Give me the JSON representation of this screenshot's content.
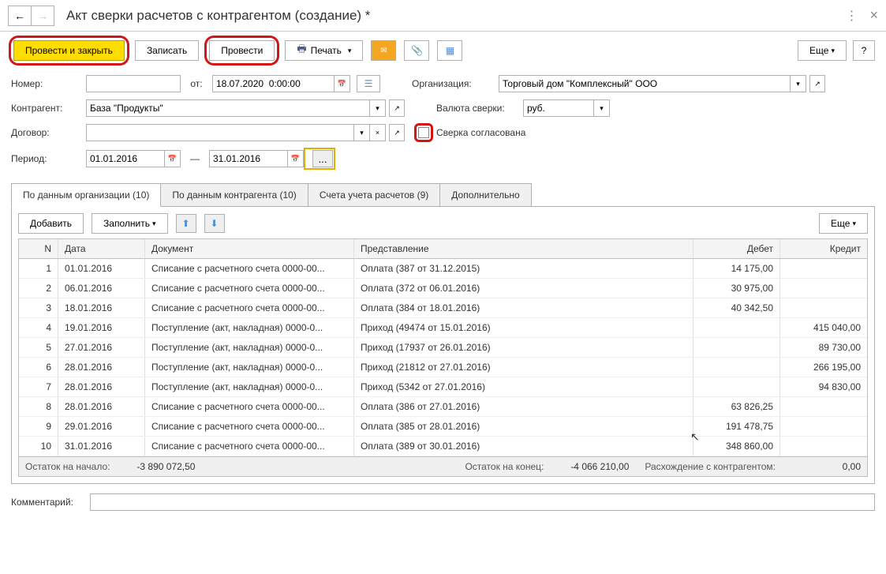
{
  "header": {
    "title": "Акт сверки расчетов с контрагентом (создание) *"
  },
  "toolbar": {
    "post_close": "Провести и закрыть",
    "write": "Записать",
    "post": "Провести",
    "print": "Печать",
    "more": "Еще"
  },
  "form": {
    "number_label": "Номер:",
    "number": "",
    "date_label": "от:",
    "date": "18.07.2020  0:00:00",
    "org_label": "Организация:",
    "org": "Торговый дом \"Комплексный\" ООО",
    "counterparty_label": "Контрагент:",
    "counterparty": "База \"Продукты\"",
    "currency_label": "Валюта сверки:",
    "currency": "руб.",
    "contract_label": "Договор:",
    "contract": "",
    "agreed_label": "Сверка согласована",
    "period_label": "Период:",
    "period_from": "01.01.2016",
    "period_to": "31.01.2016",
    "period_dash": "—"
  },
  "tabs": {
    "org_data": "По данным организации (10)",
    "cp_data": "По данным контрагента (10)",
    "accounts": "Счета учета расчетов (9)",
    "extra": "Дополнительно"
  },
  "tab_toolbar": {
    "add": "Добавить",
    "fill": "Заполнить",
    "more": "Еще"
  },
  "columns": {
    "n": "N",
    "date": "Дата",
    "doc": "Документ",
    "repr": "Представление",
    "debit": "Дебет",
    "credit": "Кредит"
  },
  "rows": [
    {
      "n": "1",
      "date": "01.01.2016",
      "doc": "Списание с расчетного счета 0000-00...",
      "repr": "Оплата (387 от 31.12.2015)",
      "debit": "14 175,00",
      "credit": ""
    },
    {
      "n": "2",
      "date": "06.01.2016",
      "doc": "Списание с расчетного счета 0000-00...",
      "repr": "Оплата (372 от 06.01.2016)",
      "debit": "30 975,00",
      "credit": ""
    },
    {
      "n": "3",
      "date": "18.01.2016",
      "doc": "Списание с расчетного счета 0000-00...",
      "repr": "Оплата (384 от 18.01.2016)",
      "debit": "40 342,50",
      "credit": ""
    },
    {
      "n": "4",
      "date": "19.01.2016",
      "doc": "Поступление (акт, накладная) 0000-0...",
      "repr": "Приход (49474 от 15.01.2016)",
      "debit": "",
      "credit": "415 040,00"
    },
    {
      "n": "5",
      "date": "27.01.2016",
      "doc": "Поступление (акт, накладная) 0000-0...",
      "repr": "Приход (17937 от 26.01.2016)",
      "debit": "",
      "credit": "89 730,00"
    },
    {
      "n": "6",
      "date": "28.01.2016",
      "doc": "Поступление (акт, накладная) 0000-0...",
      "repr": "Приход (21812 от 27.01.2016)",
      "debit": "",
      "credit": "266 195,00"
    },
    {
      "n": "7",
      "date": "28.01.2016",
      "doc": "Поступление (акт, накладная) 0000-0...",
      "repr": "Приход (5342 от 27.01.2016)",
      "debit": "",
      "credit": "94 830,00"
    },
    {
      "n": "8",
      "date": "28.01.2016",
      "doc": "Списание с расчетного счета 0000-00...",
      "repr": "Оплата (386 от 27.01.2016)",
      "debit": "63 826,25",
      "credit": ""
    },
    {
      "n": "9",
      "date": "29.01.2016",
      "doc": "Списание с расчетного счета 0000-00...",
      "repr": "Оплата (385 от 28.01.2016)",
      "debit": "191 478,75",
      "credit": ""
    },
    {
      "n": "10",
      "date": "31.01.2016",
      "doc": "Списание с расчетного счета 0000-00...",
      "repr": "Оплата (389 от 30.01.2016)",
      "debit": "348 860,00",
      "credit": ""
    }
  ],
  "footer": {
    "start_label": "Остаток на начало:",
    "start_val": "-3 890 072,50",
    "end_label": "Остаток на конец:",
    "end_val": "-4 066 210,00",
    "diff_label": "Расхождение с контрагентом:",
    "diff_val": "0,00"
  },
  "comment": {
    "label": "Комментарий:",
    "value": ""
  },
  "help": "?"
}
